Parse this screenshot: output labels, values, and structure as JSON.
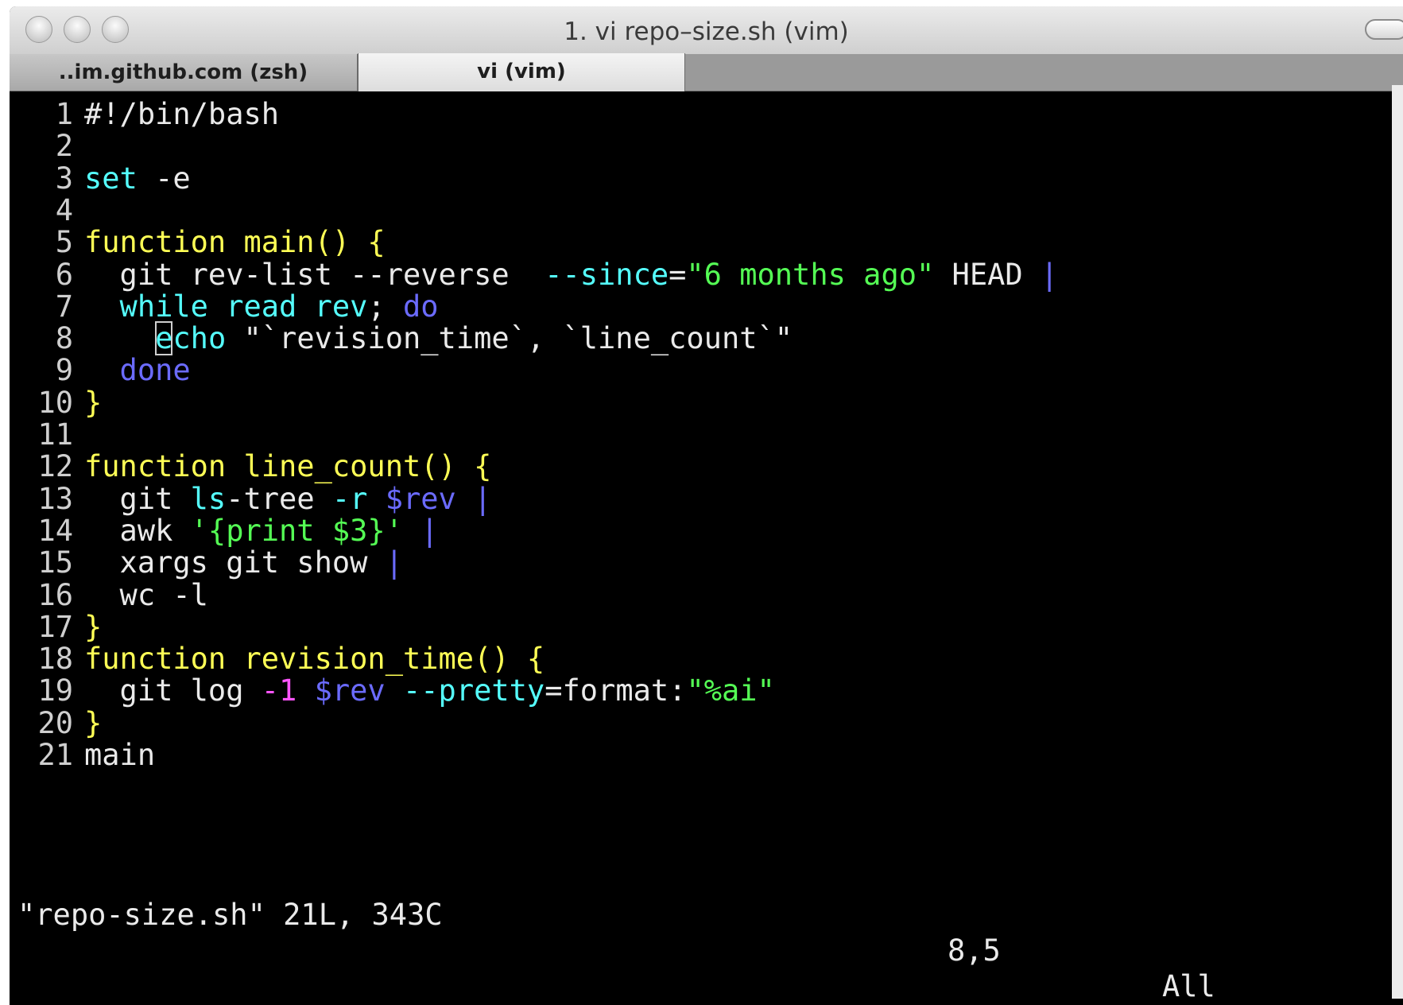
{
  "window": {
    "title": "1. vi repo–size.sh (vim)"
  },
  "tabs": [
    {
      "label": "..im.github.com (zsh)"
    },
    {
      "label": "vi (vim)"
    }
  ],
  "colors": {
    "keyword": "#55ffff",
    "func": "#ffff55",
    "string": "#55ff55",
    "statement": "#6b6bff",
    "number": "#ff55ff",
    "text": "#eaeaea"
  },
  "editor": {
    "lines": [
      {
        "num": "1",
        "tokens": [
          {
            "t": "#!/bin/bash",
            "c": "text"
          }
        ]
      },
      {
        "num": "2",
        "tokens": []
      },
      {
        "num": "3",
        "tokens": [
          {
            "t": "set",
            "c": "keyword"
          },
          {
            "t": " -e",
            "c": "text"
          }
        ]
      },
      {
        "num": "4",
        "tokens": []
      },
      {
        "num": "5",
        "tokens": [
          {
            "t": "function main() {",
            "c": "func"
          }
        ]
      },
      {
        "num": "6",
        "tokens": [
          {
            "t": "  git rev-list --reverse  ",
            "c": "text"
          },
          {
            "t": "--since",
            "c": "keyword"
          },
          {
            "t": "=",
            "c": "text"
          },
          {
            "t": "\"6 months ago\"",
            "c": "string"
          },
          {
            "t": " HEAD ",
            "c": "text"
          },
          {
            "t": "|",
            "c": "statement"
          }
        ]
      },
      {
        "num": "7",
        "tokens": [
          {
            "t": "  while read rev",
            "c": "keyword"
          },
          {
            "t": "; ",
            "c": "text"
          },
          {
            "t": "do",
            "c": "statement"
          }
        ]
      },
      {
        "num": "8",
        "tokens": [
          {
            "t": "    ",
            "c": "text"
          },
          {
            "t": "e",
            "c": "keyword",
            "cursor": true
          },
          {
            "t": "cho ",
            "c": "keyword"
          },
          {
            "t": "\"",
            "c": "text"
          },
          {
            "t": "`revision_time`, `line_count`",
            "c": "text"
          },
          {
            "t": "\"",
            "c": "text"
          }
        ]
      },
      {
        "num": "9",
        "tokens": [
          {
            "t": "  done",
            "c": "statement"
          }
        ]
      },
      {
        "num": "10",
        "tokens": [
          {
            "t": "}",
            "c": "func"
          }
        ]
      },
      {
        "num": "11",
        "tokens": []
      },
      {
        "num": "12",
        "tokens": [
          {
            "t": "function line_count() {",
            "c": "func"
          }
        ]
      },
      {
        "num": "13",
        "tokens": [
          {
            "t": "  git ",
            "c": "text"
          },
          {
            "t": "ls",
            "c": "keyword"
          },
          {
            "t": "-tree ",
            "c": "text"
          },
          {
            "t": "-r",
            "c": "keyword"
          },
          {
            "t": " ",
            "c": "text"
          },
          {
            "t": "$rev",
            "c": "statement"
          },
          {
            "t": " ",
            "c": "text"
          },
          {
            "t": "|",
            "c": "statement"
          }
        ]
      },
      {
        "num": "14",
        "tokens": [
          {
            "t": "  awk ",
            "c": "text"
          },
          {
            "t": "'{print $3}'",
            "c": "string"
          },
          {
            "t": " ",
            "c": "text"
          },
          {
            "t": "|",
            "c": "statement"
          }
        ]
      },
      {
        "num": "15",
        "tokens": [
          {
            "t": "  xargs git show ",
            "c": "text"
          },
          {
            "t": "|",
            "c": "statement"
          }
        ]
      },
      {
        "num": "16",
        "tokens": [
          {
            "t": "  wc -l",
            "c": "text"
          }
        ]
      },
      {
        "num": "17",
        "tokens": [
          {
            "t": "}",
            "c": "func"
          }
        ]
      },
      {
        "num": "18",
        "tokens": [
          {
            "t": "function revision_time() {",
            "c": "func"
          }
        ]
      },
      {
        "num": "19",
        "tokens": [
          {
            "t": "  git log ",
            "c": "text"
          },
          {
            "t": "-1",
            "c": "number"
          },
          {
            "t": " ",
            "c": "text"
          },
          {
            "t": "$rev",
            "c": "statement"
          },
          {
            "t": " ",
            "c": "text"
          },
          {
            "t": "--pretty",
            "c": "keyword"
          },
          {
            "t": "=format:",
            "c": "text"
          },
          {
            "t": "\"%ai\"",
            "c": "string"
          }
        ]
      },
      {
        "num": "20",
        "tokens": [
          {
            "t": "}",
            "c": "func"
          }
        ]
      },
      {
        "num": "21",
        "tokens": [
          {
            "t": "main",
            "c": "text"
          }
        ]
      }
    ]
  },
  "status": {
    "message": "\"repo-size.sh\" 21L, 343C",
    "position": "8,5",
    "scroll": "All"
  }
}
